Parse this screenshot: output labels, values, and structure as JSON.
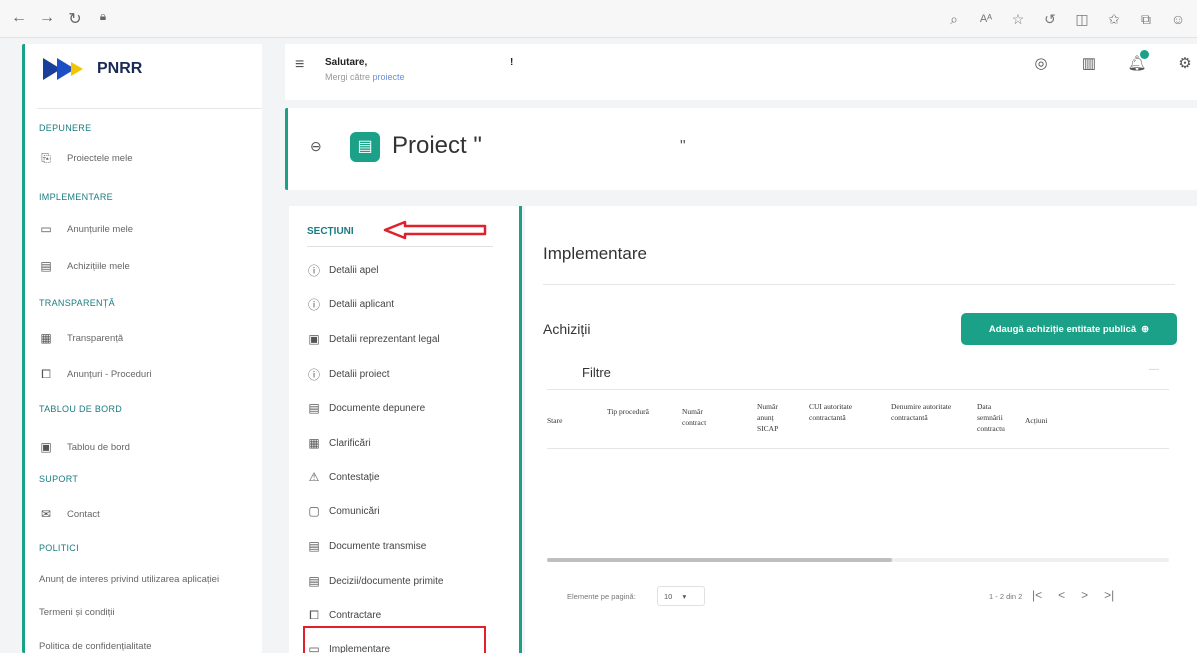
{
  "browser": {
    "nav_icons": [
      "back-icon",
      "forward-icon",
      "refresh-icon",
      "lock-icon"
    ],
    "right_icons": [
      "read-aloud-icon",
      "text-size-icon",
      "favorite-star-icon",
      "extension-icon",
      "split-screen-icon",
      "favorites-icon",
      "collections-icon",
      "profile-icon"
    ]
  },
  "sidebar": {
    "logo_text": "PNRR",
    "sections": [
      {
        "heading": "DEPUNERE",
        "items": [
          {
            "label": "Proiectele mele",
            "icon": "file-enter-icon"
          }
        ]
      },
      {
        "heading": "IMPLEMENTARE",
        "items": [
          {
            "label": "Anunțurile mele",
            "icon": "folder-icon"
          },
          {
            "label": "Achizițiile mele",
            "icon": "document-icon"
          }
        ]
      },
      {
        "heading": "TRANSPARENȚĂ",
        "items": [
          {
            "label": "Transparență",
            "icon": "table-icon"
          },
          {
            "label": "Anunțuri - Proceduri",
            "icon": "copy-icon"
          }
        ]
      },
      {
        "heading": "TABLOU DE BORD",
        "items": [
          {
            "label": "Tablou de bord",
            "icon": "dashboard-icon"
          }
        ]
      },
      {
        "heading": "SUPORT",
        "items": [
          {
            "label": "Contact",
            "icon": "mail-icon"
          }
        ]
      },
      {
        "heading": "POLITICI",
        "links": [
          "Anunț de interes privind utilizarea aplicației",
          "Termeni și condiții",
          "Politica de confidențialitate"
        ]
      }
    ]
  },
  "header": {
    "greeting": "Salutare,",
    "greeting_end": "!",
    "goto_prefix": "Mergi către",
    "goto_link": "proiecte",
    "icons": [
      "account-icon",
      "organization-icon",
      "notification-bell-icon",
      "settings-icon"
    ]
  },
  "project": {
    "title": "Proiect \"",
    "title_end": "\""
  },
  "sections_panel": {
    "heading": "SECȚIUNI",
    "items": [
      {
        "label": "Detalii apel",
        "icon": "info-icon"
      },
      {
        "label": "Detalii aplicant",
        "icon": "info-icon"
      },
      {
        "label": "Detalii reprezentant legal",
        "icon": "id-card-icon"
      },
      {
        "label": "Detalii proiect",
        "icon": "info-icon"
      },
      {
        "label": "Documente depunere",
        "icon": "document-icon"
      },
      {
        "label": "Clarificări",
        "icon": "clipboard-icon"
      },
      {
        "label": "Contestație",
        "icon": "warning-icon"
      },
      {
        "label": "Comunicări",
        "icon": "chat-icon"
      },
      {
        "label": "Documente transmise",
        "icon": "document-icon"
      },
      {
        "label": "Decizii/documente primite",
        "icon": "document-icon"
      },
      {
        "label": "Contractare",
        "icon": "copy-icon"
      },
      {
        "label": "Implementare",
        "icon": "calendar-icon"
      }
    ]
  },
  "main": {
    "title": "Implementare",
    "achizitii_title": "Achiziții",
    "add_button": "Adaugă achiziție entitate publică",
    "filter_title": "Filtre",
    "table_headers": [
      "Stare",
      "Tip procedură",
      "Număr contract",
      "Număr anunț SICAP",
      "CUI autoritate contractantă",
      "Denumire autoritate contractantă",
      "Data semnării contractu",
      "Acțiuni"
    ],
    "pager": {
      "per_page_label": "Elemente pe pagină:",
      "per_page_value": "10",
      "range": "1 - 2 din 2"
    }
  },
  "colors": {
    "accent": "#1aa187",
    "highlight_red": "#e0202a"
  }
}
